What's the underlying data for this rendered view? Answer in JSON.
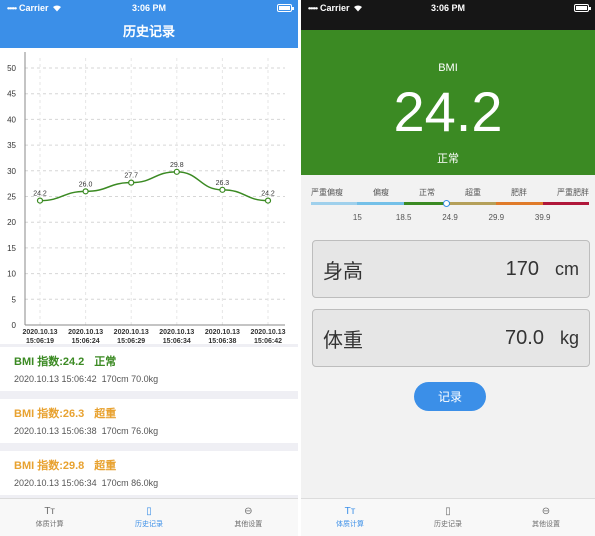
{
  "left": {
    "status": {
      "carrier": "Carrier",
      "time": "3:06 PM"
    },
    "title": "历史记录",
    "records": [
      {
        "title": "BMI 指数:24.2",
        "status": "正常",
        "color": "#3b8a23",
        "time": "2020.10.13 15:06:42",
        "details": "170cm 70.0kg"
      },
      {
        "title": "BMI 指数:26.3",
        "status": "超重",
        "color": "#e8a230",
        "time": "2020.10.13 15:06:38",
        "details": "170cm 76.0kg"
      },
      {
        "title": "BMI 指数:29.8",
        "status": "超重",
        "color": "#e8a230",
        "time": "2020.10.13 15:06:34",
        "details": "170cm 86.0kg"
      }
    ],
    "tabs": [
      {
        "label": "体质计算",
        "icon": "text-format-icon",
        "active": false
      },
      {
        "label": "历史记录",
        "icon": "history-doc-icon",
        "active": true
      },
      {
        "label": "其他设置",
        "icon": "more-circle-icon",
        "active": false
      }
    ]
  },
  "chart_data": {
    "type": "line",
    "x": [
      "2020.10.13 15:06:19",
      "2020.10.13 15:06:24",
      "2020.10.13 15:06:29",
      "2020.10.13 15:06:34",
      "2020.10.13 15:06:38",
      "2020.10.13 15:06:42"
    ],
    "x_labels_line1": [
      "2020.10.13",
      "2020.10.13",
      "2020.10.13",
      "2020.10.13",
      "2020.10.13",
      "2020.10.13"
    ],
    "x_labels_line2": [
      "15:06:19",
      "15:06:24",
      "15:06:29",
      "15:06:34",
      "15:06:38",
      "15:06:42"
    ],
    "series": [
      {
        "values": [
          24.2,
          26.0,
          27.7,
          29.8,
          26.3,
          24.2
        ]
      }
    ],
    "point_labels": [
      "24.2",
      "26.0",
      "27.7",
      "29.8",
      "26.3",
      "24.2"
    ],
    "y_ticks": [
      0,
      5,
      10,
      15,
      20,
      25,
      30,
      35,
      40,
      45,
      50
    ],
    "ylim": [
      0,
      50
    ],
    "grid": true,
    "line_color": "#3b8a23"
  },
  "right": {
    "status": {
      "carrier": "Carrier",
      "time": "3:06 PM"
    },
    "bmi_label": "BMI",
    "bmi_value": "24.2",
    "bmi_status": "正常",
    "hero_color": "#3b8a23",
    "scale": {
      "categories": [
        "严重偏瘦",
        "偏瘦",
        "正常",
        "超重",
        "肥胖",
        "严重肥胖"
      ],
      "colors": [
        "#9fd0ec",
        "#74c0e8",
        "#3b8a23",
        "#b5a05a",
        "#e07b2a",
        "#b0173a"
      ],
      "values": [
        "15",
        "18.5",
        "24.9",
        "29.9",
        "39.9"
      ],
      "marker_position": 0.484
    },
    "height": {
      "label": "身高",
      "value": "170",
      "unit": "cm"
    },
    "weight": {
      "label": "体重",
      "value": "70.0",
      "unit": "kg"
    },
    "record_button": "记录",
    "tabs": [
      {
        "label": "体质计算",
        "icon": "text-format-icon",
        "active": true
      },
      {
        "label": "历史记录",
        "icon": "history-doc-icon",
        "active": false
      },
      {
        "label": "其他设置",
        "icon": "more-circle-icon",
        "active": false
      }
    ]
  }
}
